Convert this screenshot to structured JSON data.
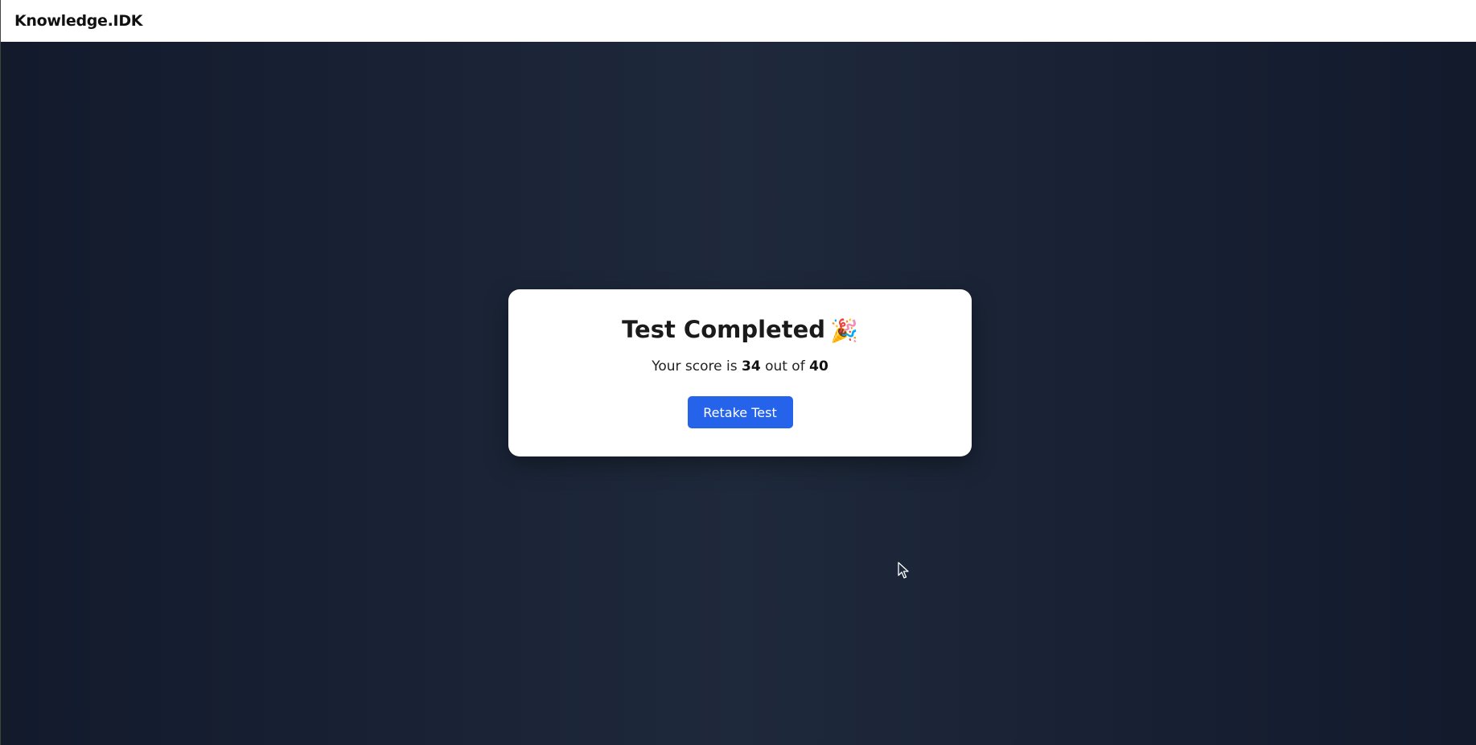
{
  "header": {
    "brand": "Knowledge.IDK"
  },
  "result": {
    "title": "Test Completed",
    "title_emoji": "🎉",
    "score_prefix": "Your score is",
    "score": "34",
    "score_mid": "out of",
    "total": "40",
    "retake_label": "Retake Test"
  },
  "colors": {
    "background": "#1e293b",
    "accent": "#2563eb",
    "card": "#ffffff"
  }
}
